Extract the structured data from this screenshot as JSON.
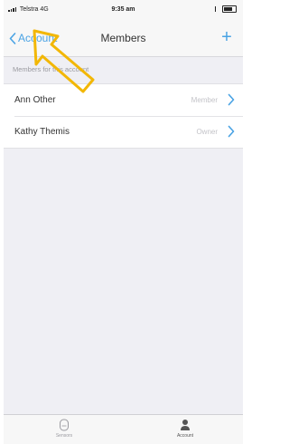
{
  "status_bar": {
    "carrier": "Telstra",
    "network": "4G",
    "time": "9:35 am"
  },
  "nav": {
    "back_label": "Account",
    "title": "Members",
    "add_label": "+"
  },
  "section": {
    "header": "Members for this account"
  },
  "members": [
    {
      "name": "Ann Other",
      "role": "Member"
    },
    {
      "name": "Kathy Themis",
      "role": "Owner"
    }
  ],
  "tabs": [
    {
      "label": "Sensors",
      "icon": "sensor-icon"
    },
    {
      "label": "Account",
      "icon": "person-icon",
      "selected": true
    }
  ],
  "colors": {
    "accent": "#4aa3e4",
    "annotation": "#f2b705"
  }
}
